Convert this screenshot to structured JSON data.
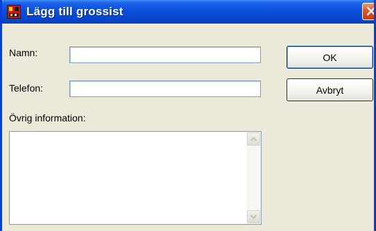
{
  "window": {
    "title": "Lägg till grossist"
  },
  "form": {
    "name_label": "Namn:",
    "name_value": "",
    "phone_label": "Telefon:",
    "phone_value": "",
    "info_label": "Övrig information:",
    "info_value": ""
  },
  "buttons": {
    "ok_label": "OK",
    "cancel_label": "Avbryt"
  },
  "icons": {
    "app": "app-icon",
    "close": "close-icon",
    "scroll_up": "scroll-up-arrow-icon",
    "scroll_down": "scroll-down-arrow-icon"
  },
  "colors": {
    "titlebar": "#0a4fd8",
    "close": "#e2552a",
    "dialog_bg": "#ece9d8",
    "input_border": "#7f9db9"
  }
}
